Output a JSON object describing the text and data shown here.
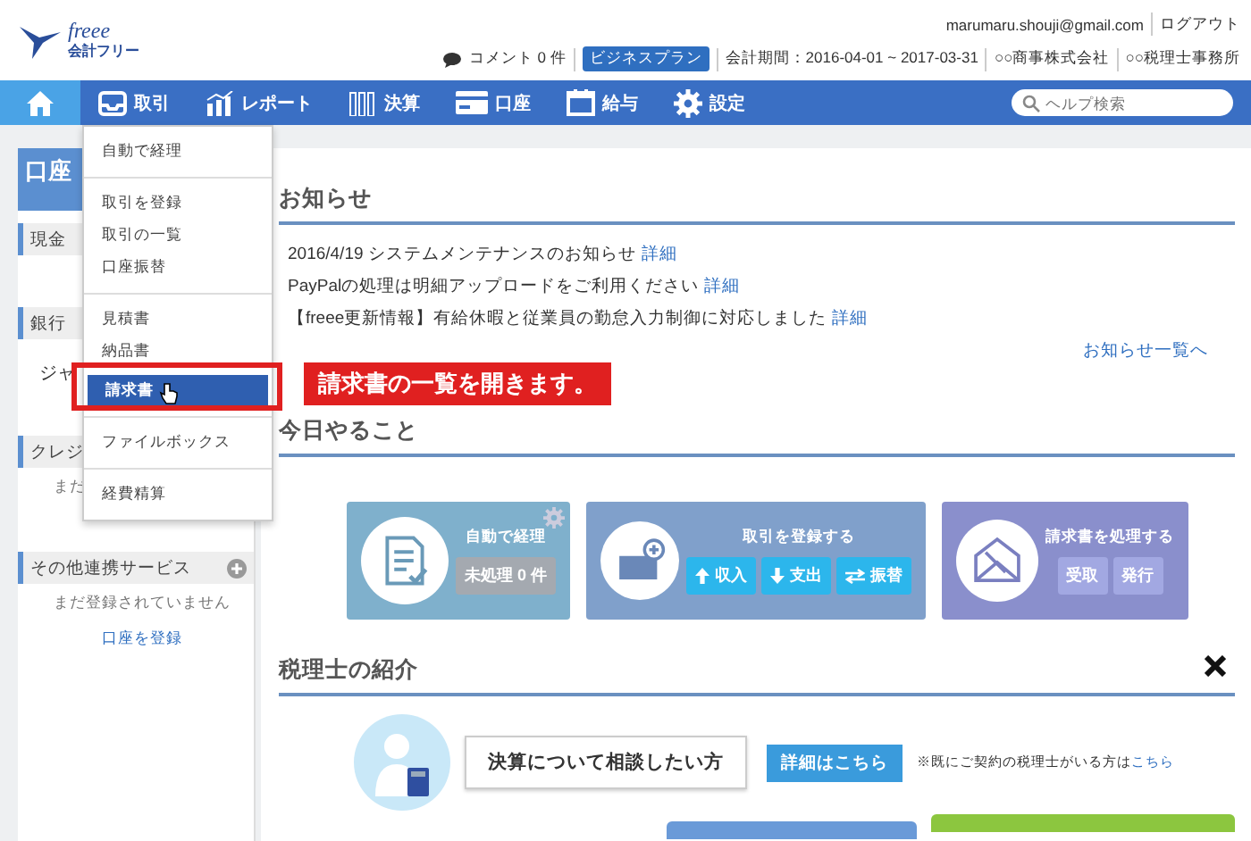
{
  "header": {
    "wordmark": "freee",
    "logo_text": "会計フリー",
    "email": "marumaru.shouji@gmail.com",
    "logout": "ログアウト",
    "comment": "コメント 0 件",
    "plan": "ビジネスプラン",
    "period": "会計期間：2016-04-01 ~ 2017-03-31",
    "company": "○○商事株式会社",
    "tax_office": "○○税理士事務所"
  },
  "nav": {
    "home_selected": true,
    "items": [
      {
        "label": "取引",
        "kind": "tray",
        "selected": false
      },
      {
        "label": "レポート",
        "kind": "chart",
        "selected": false
      },
      {
        "label": "決算",
        "kind": "books",
        "selected": false
      },
      {
        "label": "口座",
        "kind": "card",
        "selected": false
      },
      {
        "label": "給与",
        "kind": "calendar",
        "selected": false
      },
      {
        "label": "設定",
        "kind": "gear",
        "selected": false
      }
    ],
    "search": {
      "placeholder": "ヘルプ検索"
    }
  },
  "sidebar": {
    "title": "口座",
    "sections": [
      {
        "label": "現金",
        "plus": false
      },
      {
        "label": "銀行",
        "lines": [
          {
            "text": "ジャ",
            "kind": "item"
          }
        ],
        "plus": false
      },
      {
        "label": "クレジ",
        "lines": [
          {
            "text": "まだ",
            "kind": "empty"
          }
        ],
        "plus": false
      },
      {
        "label": "その他連携サービス",
        "lines": [
          {
            "text": "まだ登録されていません",
            "kind": "empty"
          },
          {
            "text": "口座を登録",
            "kind": "link"
          }
        ],
        "plus": true
      }
    ]
  },
  "menu": {
    "groups": [
      [
        {
          "label": "自動で経理",
          "selected": false
        }
      ],
      [
        {
          "label": "取引を登録",
          "selected": false
        },
        {
          "label": "取引の一覧",
          "selected": false
        },
        {
          "label": "口座振替",
          "selected": false
        }
      ],
      [
        {
          "label": "見積書",
          "selected": false
        },
        {
          "label": "納品書",
          "selected": false
        },
        {
          "label": "請求書",
          "selected": true
        }
      ],
      [
        {
          "label": "ファイルボックス",
          "selected": false
        }
      ],
      [
        {
          "label": "経費精算",
          "selected": false
        }
      ]
    ]
  },
  "callout": "請求書の一覧を開きます。",
  "notices": {
    "title": "お知らせ",
    "items": [
      {
        "text": "2016/4/19 システムメンテナンスのお知らせ",
        "link": "詳細"
      },
      {
        "text": "PayPalの処理は明細アップロードをご利用ください",
        "link": "詳細"
      },
      {
        "text": "【freee更新情報】有給休暇と従業員の勤怠入力制御に対応しました",
        "link": "詳細"
      }
    ],
    "more": "お知らせ一覧へ"
  },
  "today": {
    "title": "今日やること",
    "cards": [
      {
        "title": "自動で経理",
        "kind": "auto",
        "color": "#7fb0cc",
        "settings": true,
        "buttons": [
          {
            "label": "未処理 0 件",
            "kind": "count"
          }
        ]
      },
      {
        "title": "取引を登録する",
        "kind": "register",
        "color": "#80a0cb",
        "settings": false,
        "buttons": [
          {
            "label": "収入",
            "kind": "up"
          },
          {
            "label": "支出",
            "kind": "down"
          },
          {
            "label": "振替",
            "kind": "swap"
          }
        ]
      },
      {
        "title": "請求書を処理する",
        "kind": "invoice",
        "color": "#8a8fcc",
        "settings": false,
        "buttons": [
          {
            "label": "受取",
            "kind": "plain"
          },
          {
            "label": "発行",
            "kind": "plain"
          }
        ]
      }
    ]
  },
  "advisors": {
    "title": "税理士の紹介",
    "bubble": "決算について相談したい方",
    "button": "詳細はこちら",
    "note": "※既にご契約の税理士がいる方は",
    "note_link": "こちら"
  }
}
